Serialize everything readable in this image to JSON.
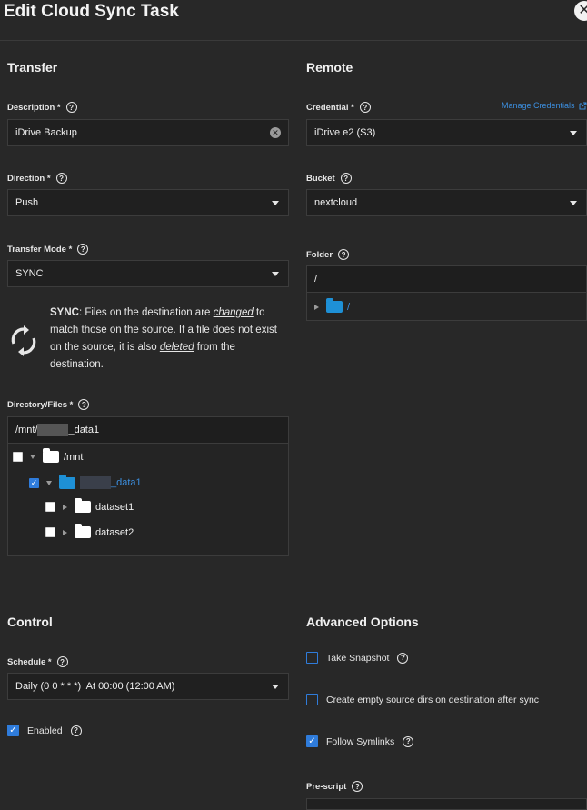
{
  "dialog": {
    "title": "Edit Cloud Sync Task",
    "close_glyph": "✕"
  },
  "transfer": {
    "section_title": "Transfer",
    "description": {
      "label": "Description",
      "value": "iDrive Backup"
    },
    "direction": {
      "label": "Direction",
      "value": "Push"
    },
    "transfer_mode": {
      "label": "Transfer Mode",
      "value": "SYNC"
    },
    "mode_help": {
      "keyword": "SYNC",
      "part1": ": Files on the destination are ",
      "changed": "changed",
      "part2": " to match those on the source. If a file does not exist on the source, it is also ",
      "deleted": "deleted",
      "part3": " from the destination."
    },
    "directory_files": {
      "label": "Directory/Files",
      "path_prefix": "/mnt/",
      "path_suffix": "_data1",
      "tree": [
        {
          "name": "/mnt",
          "checked": false,
          "expanded": true
        },
        {
          "name": "_data1",
          "checked": true,
          "expanded": true
        },
        {
          "name": "dataset1",
          "checked": false,
          "expanded": false
        },
        {
          "name": "dataset2",
          "checked": false,
          "expanded": false
        }
      ]
    }
  },
  "remote": {
    "section_title": "Remote",
    "credential": {
      "label": "Credential",
      "value": "iDrive e2 (S3)",
      "manage_link": "Manage Credentials"
    },
    "bucket": {
      "label": "Bucket",
      "value": "nextcloud"
    },
    "folder": {
      "label": "Folder",
      "value": "/",
      "tree_root": "/"
    }
  },
  "control": {
    "section_title": "Control",
    "schedule": {
      "label": "Schedule",
      "value": "Daily (0 0 * * *)  At 00:00 (12:00 AM)"
    },
    "enabled": {
      "label": "Enabled",
      "checked": true
    }
  },
  "advanced": {
    "section_title": "Advanced Options",
    "take_snapshot": {
      "label": "Take Snapshot",
      "checked": false
    },
    "create_empty_dirs": {
      "label": "Create empty source dirs on destination after sync",
      "checked": false
    },
    "follow_symlinks": {
      "label": "Follow Symlinks",
      "checked": true
    },
    "pre_script": {
      "label": "Pre-script"
    }
  },
  "common": {
    "required_mark": "*",
    "help_glyph": "?",
    "check_glyph": "✓"
  },
  "colors": {
    "accent": "#2f7cdb",
    "folder_blue": "#1e90d6",
    "background": "#282828",
    "field": "#202020"
  }
}
